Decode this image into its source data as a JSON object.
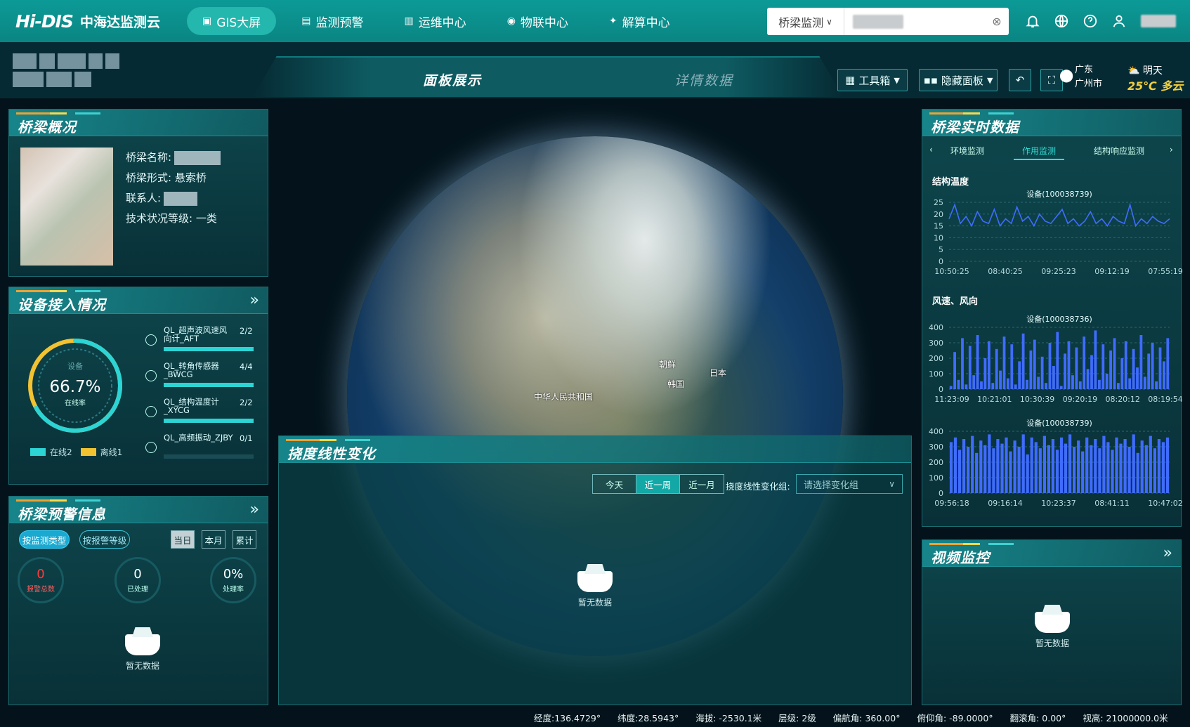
{
  "nav": {
    "logo": "Hi-DIS",
    "logo_text": "中海达监测云",
    "items": [
      {
        "label": "GIS大屏",
        "icon": "monitor-icon"
      },
      {
        "label": "监测预警",
        "icon": "alert-icon"
      },
      {
        "label": "运维中心",
        "icon": "building-icon"
      },
      {
        "label": "物联中心",
        "icon": "iot-icon"
      },
      {
        "label": "解算中心",
        "icon": "compute-icon"
      }
    ],
    "search_type": "桥梁监测",
    "search_clear": "⊗"
  },
  "subbar": {
    "tab_active": "面板展示",
    "tab_inactive": "详情数据",
    "toolbox": "工具箱",
    "hide_panel": "隐藏面板",
    "province": "广东",
    "city": "广州市",
    "weather_day": "明天",
    "weather_temp": "25℃",
    "weather_desc": "多云"
  },
  "overview": {
    "title": "桥梁概况",
    "name_label": "桥梁名称:",
    "form_label": "桥梁形式:",
    "form_value": "悬索桥",
    "contact_label": "联系人:",
    "grade_label": "技术状况等级:",
    "grade_value": "一类"
  },
  "device": {
    "title": "设备接入情况",
    "ring_caption": "设备",
    "ring_value": "66.7%",
    "ring_sub": "在线率",
    "online_pct": 0.667,
    "legend_online": "在线2",
    "legend_offline": "离线1",
    "rows": [
      {
        "name": "QL_超声波风速风向计_AFT",
        "count": "2/2",
        "ratio": 1.0
      },
      {
        "name": "QL_转角传感器_BWCG",
        "count": "4/4",
        "ratio": 1.0
      },
      {
        "name": "QL_结构温度计_XYCG",
        "count": "2/2",
        "ratio": 1.0
      },
      {
        "name": "QL_高频振动_ZJBY",
        "count": "0/1",
        "ratio": 0.0
      }
    ]
  },
  "warning": {
    "title": "桥梁预警信息",
    "by_type": "按监测类型",
    "by_level": "按报警等级",
    "today": "当日",
    "month": "本月",
    "total": "累计",
    "stat_total": "0",
    "stat_total_label": "报警总数",
    "stat_done": "0",
    "stat_done_label": "已处理",
    "stat_rate": "0%",
    "stat_rate_label": "处理率",
    "nodata": "暂无数据"
  },
  "map": {
    "labels": [
      {
        "text": "中华人民共和国"
      },
      {
        "text": "朝鲜"
      },
      {
        "text": "韩国"
      },
      {
        "text": "日本"
      }
    ]
  },
  "deflection": {
    "title": "挠度线性变化",
    "today": "今天",
    "week": "近一周",
    "month": "近一月",
    "group_label": "挠度线性变化组:",
    "group_placeholder": "请选择变化组",
    "nodata": "暂无数据"
  },
  "realtime": {
    "title": "桥梁实时数据",
    "tabs": [
      "环境监测",
      "作用监测",
      "结构响应监测"
    ],
    "temp_title": "结构温度",
    "temp_device": "设备(100038739)",
    "wind_title": "风速、风向",
    "wind_device1": "设备(100038736)",
    "wind_device2": "设备(100038739)"
  },
  "video": {
    "title": "视频监控",
    "nodata": "暂无数据"
  },
  "status": {
    "lon": "经度:136.4729°",
    "lat": "纬度:28.5943°",
    "alt": "海拔: -2530.1米",
    "level": "层级: 2级",
    "heading": "偏航角: 360.00°",
    "pitch": "俯仰角: -89.0000°",
    "roll": "翻滚角: 0.00°",
    "view": "视高: 21000000.0米"
  },
  "chart_data": [
    {
      "type": "line",
      "title": "结构温度",
      "series": [
        {
          "name": "设备(100038739)",
          "values": [
            18,
            24,
            16,
            19,
            15,
            21,
            17,
            16,
            22,
            15,
            18,
            16,
            23,
            17,
            19,
            15,
            20,
            17,
            16,
            19,
            22,
            16,
            18,
            15,
            17,
            21,
            16,
            18,
            15,
            19,
            17,
            16,
            24,
            15,
            18,
            16,
            19,
            17,
            16,
            18
          ]
        }
      ],
      "x": [
        "10:50:25",
        "08:40:25",
        "09:25:23",
        "09:12:19",
        "07:55:19"
      ],
      "ylim": [
        0,
        25
      ],
      "yticks": [
        0,
        5,
        10,
        15,
        20,
        25
      ],
      "color": "#3f6cff"
    },
    {
      "type": "bar",
      "title": "风速、风向",
      "series": [
        {
          "name": "设备(100038736)",
          "values": [
            20,
            240,
            60,
            330,
            30,
            280,
            90,
            350,
            50,
            200,
            310,
            40,
            260,
            120,
            340,
            70,
            290,
            30,
            180,
            360,
            60,
            250,
            320,
            80,
            210,
            40,
            300,
            150,
            370,
            20,
            230,
            310,
            90,
            270,
            50,
            340,
            130,
            220,
            380,
            60,
            290,
            100,
            250,
            330,
            40,
            200,
            310,
            70,
            260,
            140,
            350,
            80,
            230,
            300,
            50,
            270,
            180,
            330
          ]
        }
      ],
      "x": [
        "11:23:09",
        "10:21:01",
        "10:30:39",
        "09:20:19",
        "08:20:12",
        "08:19:54"
      ],
      "ylim": [
        0,
        400
      ],
      "yticks": [
        0,
        100,
        200,
        300,
        400
      ],
      "color": "#3f6cff"
    },
    {
      "type": "bar",
      "title": "风速、风向",
      "series": [
        {
          "name": "设备(100038739)",
          "values": [
            330,
            360,
            280,
            350,
            300,
            370,
            260,
            340,
            310,
            380,
            290,
            350,
            320,
            360,
            270,
            340,
            300,
            380,
            250,
            360,
            330,
            290,
            370,
            310,
            350,
            280,
            360,
            320,
            380,
            300,
            340,
            270,
            360,
            310,
            350,
            290,
            370,
            330,
            280,
            360,
            320,
            350,
            300,
            380,
            260,
            340,
            310,
            370,
            290,
            350,
            330,
            360
          ]
        }
      ],
      "x": [
        "09:56:18",
        "09:16:14",
        "10:23:37",
        "08:41:11",
        "10:47:02"
      ],
      "ylim": [
        0,
        400
      ],
      "yticks": [
        0,
        100,
        200,
        300,
        400
      ],
      "color": "#3f6cff"
    }
  ]
}
